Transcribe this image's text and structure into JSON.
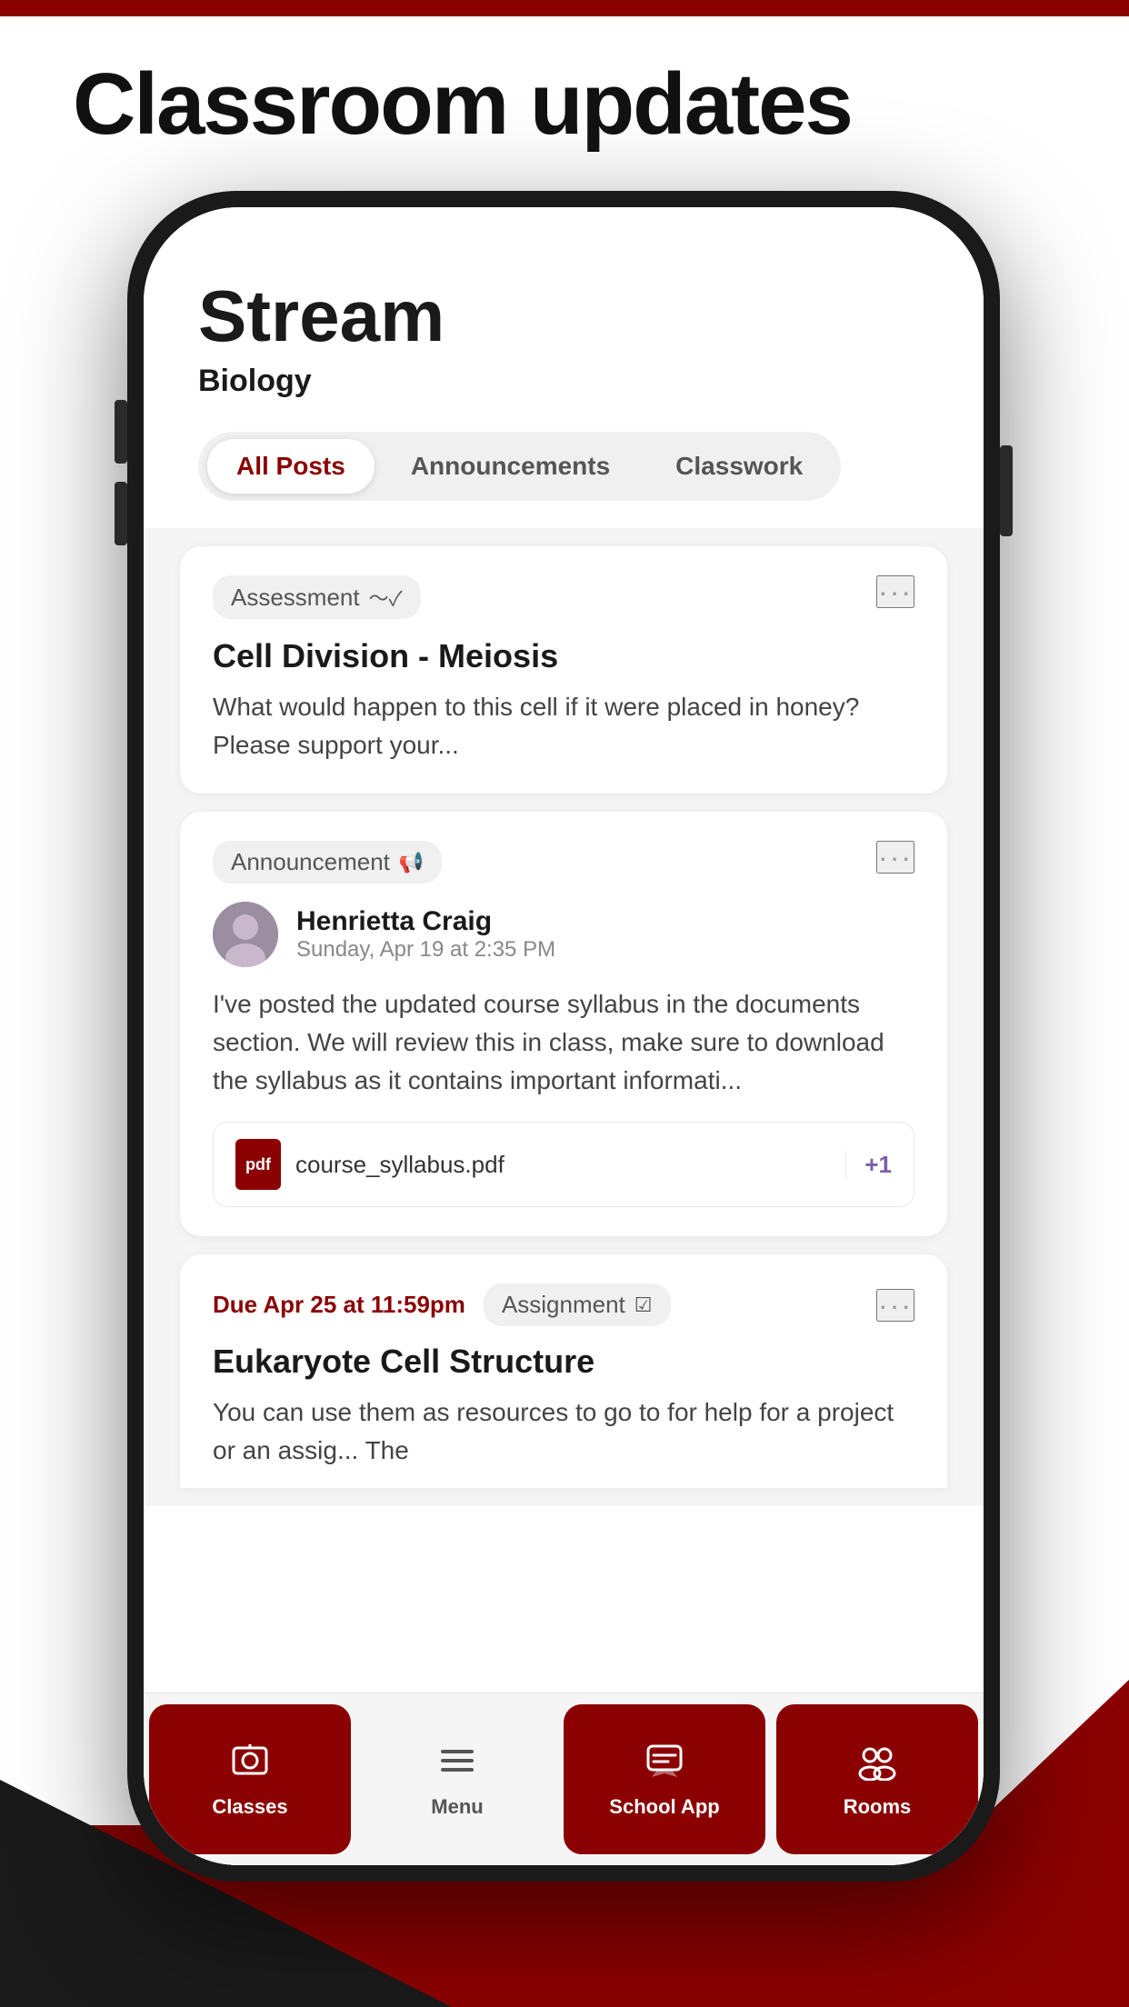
{
  "page": {
    "title": "Classroom updates",
    "background_top_color": "#8B0000"
  },
  "stream": {
    "title": "Stream",
    "subtitle": "Biology"
  },
  "filter_tabs": {
    "items": [
      {
        "label": "All Posts",
        "active": true
      },
      {
        "label": "Announcements",
        "active": false
      },
      {
        "label": "Classwork",
        "active": false
      }
    ]
  },
  "cards": [
    {
      "type": "assessment",
      "tag": "Assessment",
      "title": "Cell Division - Meiosis",
      "body": "What would happen to this cell if it were placed in honey? Please support your..."
    },
    {
      "type": "announcement",
      "tag": "Announcement",
      "author_name": "Henrietta Craig",
      "author_time": "Sunday, Apr 19 at 2:35 PM",
      "body": "I've posted the updated course syllabus in the documents section. We will review this in class, make sure to download the syllabus as it contains important informati...",
      "attachment": "course_syllabus.pdf",
      "attachment_extra": "+1"
    },
    {
      "type": "assignment",
      "due": "Due Apr 25 at 11:59pm",
      "tag": "Assignment",
      "title": "Eukaryote Cell Structure",
      "body": "You can use them as resources to go to for help for a project or an assig... The"
    }
  ],
  "bottom_nav": {
    "items": [
      {
        "label": "Classes",
        "icon": "🎓",
        "active": true
      },
      {
        "label": "Menu",
        "icon": "☰",
        "active": false
      },
      {
        "label": "School App",
        "icon": "💬",
        "active": true
      },
      {
        "label": "Rooms",
        "icon": "👥",
        "active": true
      }
    ]
  }
}
